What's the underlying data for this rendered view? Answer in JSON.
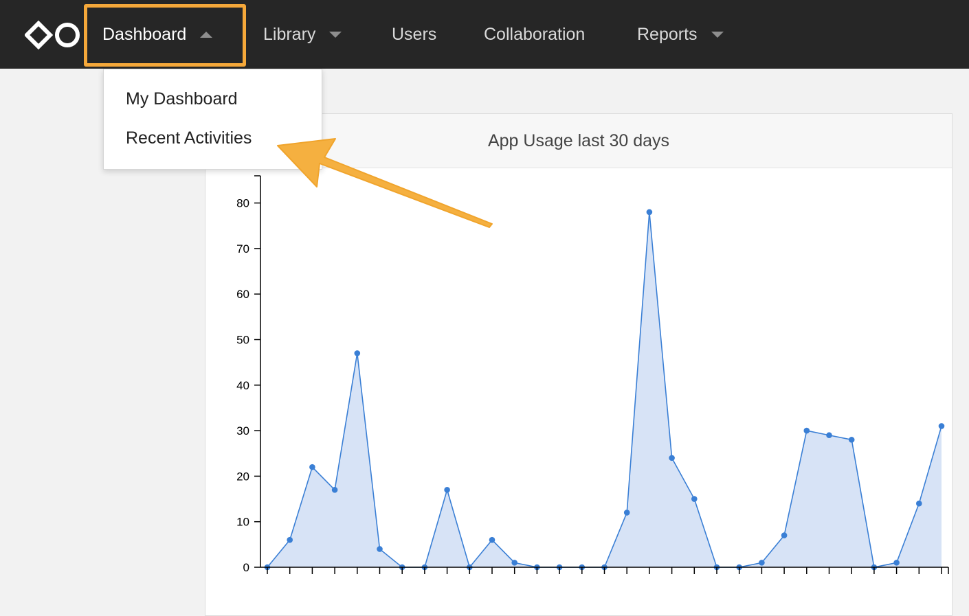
{
  "nav": {
    "items": [
      {
        "label": "Dashboard",
        "has_caret": true,
        "caret": "up",
        "active": true
      },
      {
        "label": "Library",
        "has_caret": true,
        "caret": "down",
        "active": false
      },
      {
        "label": "Users",
        "has_caret": false,
        "active": false
      },
      {
        "label": "Collaboration",
        "has_caret": false,
        "active": false
      },
      {
        "label": "Reports",
        "has_caret": true,
        "caret": "down",
        "active": false
      }
    ]
  },
  "dropdown": {
    "items": [
      {
        "label": "My Dashboard"
      },
      {
        "label": "Recent Activities"
      }
    ]
  },
  "panel": {
    "title": "App Usage last 30 days"
  },
  "colors": {
    "nav_bg": "#262626",
    "highlight": "#f5a83a",
    "series_line": "#3a7fd5",
    "series_fill": "#d7e3f6"
  },
  "chart_data": {
    "type": "area",
    "x": [
      1,
      2,
      3,
      4,
      5,
      6,
      7,
      8,
      9,
      10,
      11,
      12,
      13,
      14,
      15,
      16,
      17,
      18,
      19,
      20,
      21,
      22,
      23,
      24,
      25,
      26,
      27,
      28,
      29,
      30,
      31
    ],
    "values": [
      0,
      6,
      22,
      17,
      47,
      4,
      0,
      0,
      17,
      0,
      6,
      1,
      0,
      0,
      0,
      0,
      12,
      78,
      24,
      15,
      0,
      0,
      1,
      7,
      30,
      29,
      28,
      0,
      1,
      14,
      31
    ],
    "yticks": [
      0,
      10,
      20,
      30,
      40,
      50,
      60,
      70,
      80
    ],
    "ylim": [
      0,
      86
    ],
    "title": "App Usage last 30 days",
    "xlabel": "",
    "ylabel": ""
  }
}
